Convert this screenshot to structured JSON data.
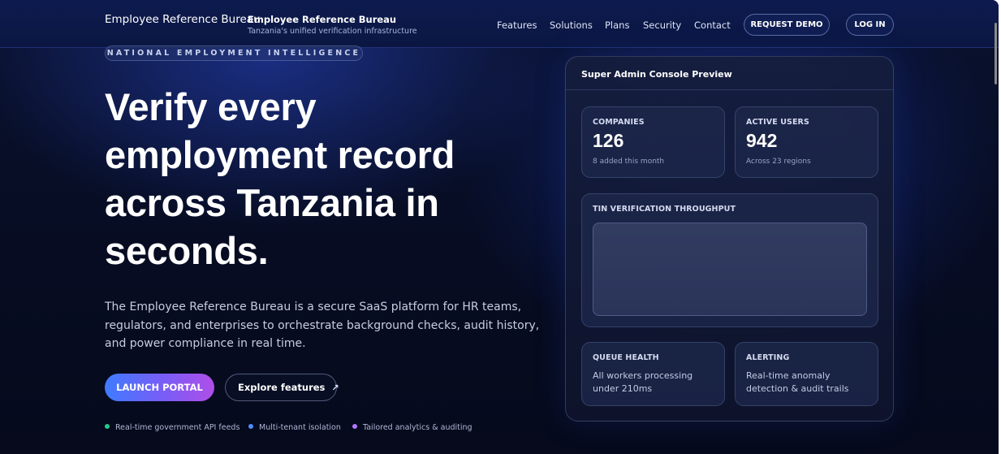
{
  "header": {
    "brand_main": "Employee Reference Bureau",
    "brand_title": "Employee Reference Bureau",
    "brand_tagline": "Tanzania's unified verification infrastructure",
    "nav": [
      "Features",
      "Solutions",
      "Plans",
      "Security",
      "Contact"
    ],
    "request_demo": "REQUEST DEMO",
    "login": "LOG IN"
  },
  "hero": {
    "eyebrow": "NATIONAL EMPLOYMENT INTELLIGENCE",
    "headline_lines": [
      "Verify every",
      "employment record",
      "across Tanzania in",
      "seconds."
    ],
    "description": "The Employee Reference Bureau is a secure SaaS platform for HR teams, regulators, and enterprises to orchestrate background checks, audit history, and power compliance in real time.",
    "launch_button": "LAUNCH PORTAL",
    "explore_button": "Explore features",
    "explore_icon": "arrow-up-right-icon",
    "features": [
      {
        "label": "Real-time government API feeds",
        "color": "#22c98a"
      },
      {
        "label": "Multi-tenant isolation",
        "color": "#4f8dff"
      },
      {
        "label": "Tailored analytics & auditing",
        "color": "#b276ff"
      }
    ]
  },
  "console": {
    "title": "Super Admin Console Preview",
    "companies": {
      "label": "COMPANIES",
      "value": "126",
      "sub": "8 added this month"
    },
    "active_users": {
      "label": "ACTIVE USERS",
      "value": "942",
      "sub": "Across 23 regions"
    },
    "throughput": {
      "label": "TIN VERIFICATION THROUGHPUT"
    },
    "queue_health": {
      "label": "QUEUE HEALTH",
      "text": "All workers processing under 210ms"
    },
    "alerting": {
      "label": "ALERTING",
      "text": "Real-time anomaly detection & audit trails"
    }
  },
  "colors": {
    "accent_start": "#3f7bff",
    "accent_end": "#b04ee8",
    "background": "#070d24"
  }
}
